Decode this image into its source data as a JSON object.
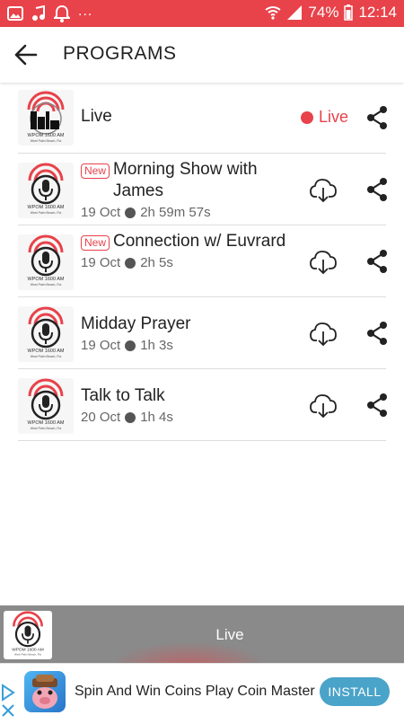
{
  "status_bar": {
    "dots": "...",
    "battery": "74%",
    "time": "12:14",
    "color": "#e8424a"
  },
  "header": {
    "title": "PROGRAMS"
  },
  "logo": {
    "brand": "WPOM 1600 AM",
    "location": "West Palm Beach, Fla"
  },
  "programs": [
    {
      "title": "Live",
      "type": "live",
      "live_label": "Live"
    },
    {
      "title": "Morning Show with James",
      "new_label": "New",
      "date": "19 Oct",
      "duration": "2h 59m 57s"
    },
    {
      "title": "Connection w/ Euvrard",
      "new_label": "New",
      "date": "19 Oct",
      "duration": "2h 5s"
    },
    {
      "title": "Midday Prayer",
      "date": "19 Oct",
      "duration": "1h 3s"
    },
    {
      "title": "Talk to Talk",
      "date": "20 Oct",
      "duration": "1h 4s"
    }
  ],
  "player": {
    "label": "Live"
  },
  "ad": {
    "text": "Spin And Win Coins Play Coin Master",
    "button": "INSTALL"
  }
}
